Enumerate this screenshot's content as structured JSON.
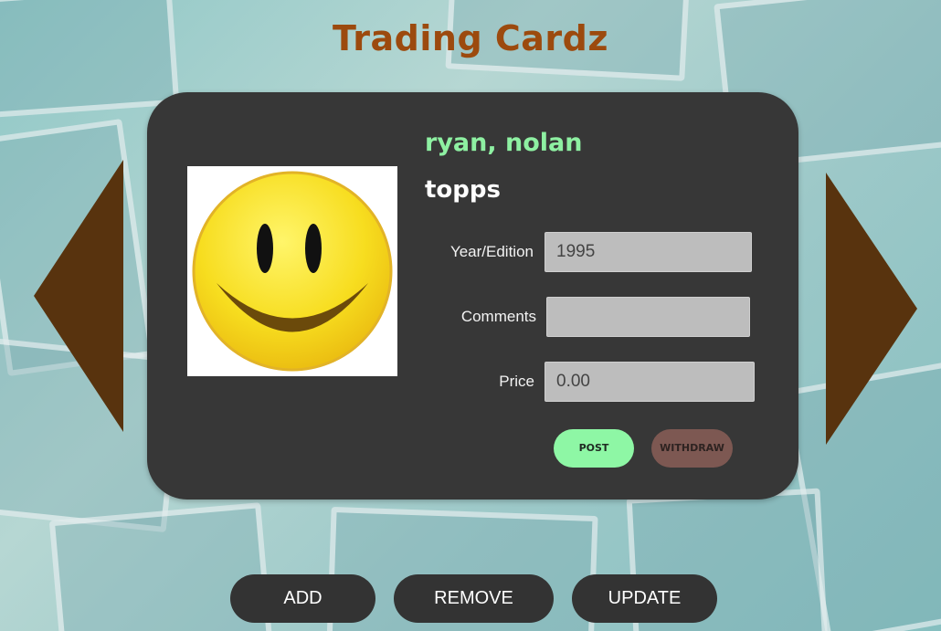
{
  "app": {
    "title": "Trading Cardz"
  },
  "card": {
    "player_name": "ryan, nolan",
    "brand": "topps",
    "image_icon": "smiley-face-icon",
    "fields": {
      "year_label": "Year/Edition",
      "year_value": "1995",
      "comments_label": "Comments",
      "comments_value": "",
      "price_label": "Price",
      "price_value": "0.00"
    },
    "actions": {
      "post_label": "POST",
      "withdraw_label": "WITHDRAW"
    }
  },
  "nav": {
    "prev_icon": "triangle-left-icon",
    "next_icon": "triangle-right-icon"
  },
  "toolbar": {
    "add_label": "ADD",
    "remove_label": "REMOVE",
    "update_label": "UPDATE"
  },
  "colors": {
    "title": "#9c4a0e",
    "card_bg": "#373737",
    "player_name": "#8ef0a2",
    "post_button": "#8ef7a5",
    "withdraw_button": "#7d5852",
    "arrows": "#58330e",
    "bottom_buttons": "#333333"
  }
}
